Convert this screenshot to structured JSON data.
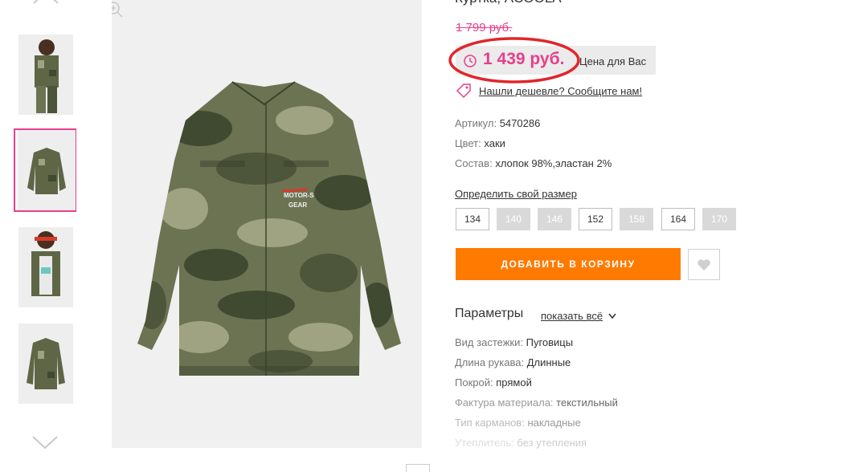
{
  "product": {
    "title": "Куртка, ACOOLA",
    "old_price": "1 799 руб.",
    "price": "1 439 руб.",
    "price_label": "Цена для Вас",
    "cheaper_link": "Нашли дешевле? Сообщите нам!"
  },
  "attributes": [
    {
      "label": "Артикул:",
      "value": "5470286"
    },
    {
      "label": "Цвет:",
      "value": "хаки"
    },
    {
      "label": "Состав:",
      "value": "хлопок 98%,эластан 2%"
    }
  ],
  "sizes": {
    "link": "Определить свой размер",
    "items": [
      {
        "label": "134",
        "available": true
      },
      {
        "label": "140",
        "available": false
      },
      {
        "label": "146",
        "available": false
      },
      {
        "label": "152",
        "available": true
      },
      {
        "label": "158",
        "available": false
      },
      {
        "label": "164",
        "available": true
      },
      {
        "label": "170",
        "available": false
      }
    ]
  },
  "actions": {
    "add_to_cart": "ДОБАВИТЬ В КОРЗИНУ"
  },
  "params": {
    "heading": "Параметры",
    "show_all": "показать всё",
    "items": [
      {
        "label": "Вид застежки:",
        "value": "Пуговицы"
      },
      {
        "label": "Длина рукава:",
        "value": "Длинные"
      },
      {
        "label": "Покрой:",
        "value": "прямой"
      },
      {
        "label": "Фактура материала:",
        "value": "текстильный"
      },
      {
        "label": "Тип карманов:",
        "value": "накладные"
      },
      {
        "label": "Утеплитель:",
        "value": "без утепления"
      }
    ]
  },
  "jacket_patch": {
    "line1": "MOTOR-S",
    "line2": "GEAR"
  },
  "colors": {
    "accent": "#e83e8c",
    "cart": "#ff7a00",
    "camo_dark": "#3f4a30",
    "camo_mid": "#6b7352",
    "camo_light": "#9fa382"
  },
  "icons": [
    "chevron-up-icon",
    "chevron-down-icon",
    "zoom-icon",
    "clock-icon",
    "tag-icon",
    "heart-icon"
  ]
}
